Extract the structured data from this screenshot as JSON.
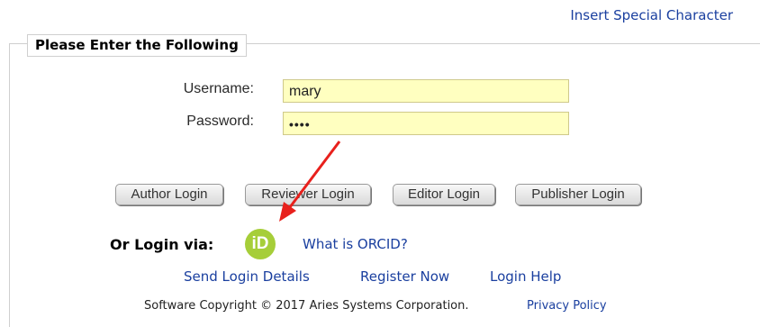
{
  "header": {
    "insert_special_character": "Insert Special Character"
  },
  "form": {
    "legend": "Please Enter the Following",
    "username": {
      "label": "Username:",
      "value": "mary"
    },
    "password": {
      "label": "Password:",
      "value": "••••"
    }
  },
  "buttons": {
    "author": "Author Login",
    "reviewer": "Reviewer Login",
    "editor": "Editor Login",
    "publisher": "Publisher Login"
  },
  "orcid": {
    "label": "Or Login via:",
    "icon_text": "iD",
    "what_is": "What is ORCID?",
    "icon_color": "#a6ce39"
  },
  "links": {
    "send_login_details": "Send Login Details",
    "register_now": "Register Now",
    "login_help": "Login Help"
  },
  "footer": {
    "copyright": "Software Copyright © 2017 Aries Systems Corporation.",
    "privacy_policy": "Privacy Policy"
  },
  "colors": {
    "link": "#1a3f9f",
    "field_bg": "#ffffc0",
    "annotation_arrow": "#e8201c"
  }
}
